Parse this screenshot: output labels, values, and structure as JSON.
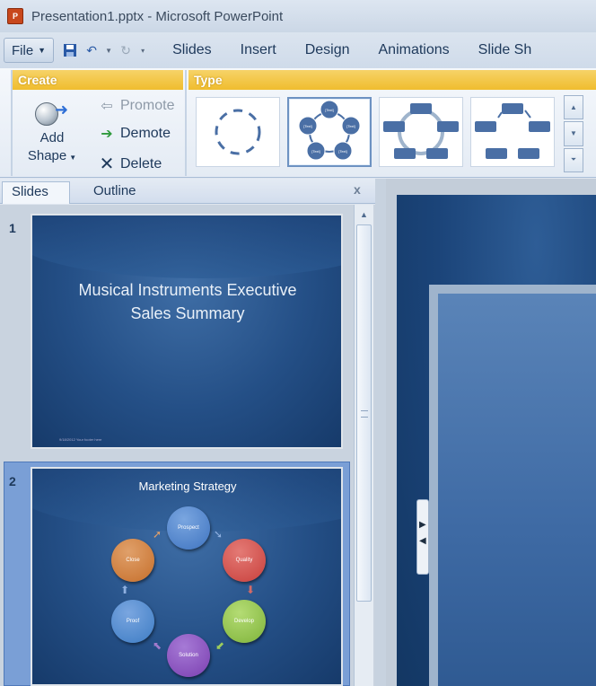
{
  "window": {
    "title": "Presentation1.pptx - Microsoft PowerPoint",
    "app_icon": "P"
  },
  "file_menu": {
    "label": "File"
  },
  "tabs": [
    "Slides",
    "Insert",
    "Design",
    "Animations",
    "Slide Sh"
  ],
  "ribbon": {
    "create_group": "Create",
    "type_group": "Type",
    "add_shape_line1": "Add",
    "add_shape_line2": "Shape",
    "promote": "Promote",
    "demote": "Demote",
    "delete": "Delete",
    "edge_labels": [
      "S",
      "T"
    ]
  },
  "smartart_thumb_text": "[Text]",
  "pane": {
    "tab_slides": "Slides",
    "tab_outline": "Outline",
    "close": "x"
  },
  "slides": [
    {
      "number": "1",
      "title_line1": "Musical Instruments Executive",
      "title_line2": "Sales Summary",
      "footer": "9/18/2012      Your footer here"
    },
    {
      "number": "2",
      "title": "Marketing Strategy",
      "nodes": [
        {
          "label": "Prospect",
          "color": "#3f74c0"
        },
        {
          "label": "Quality",
          "color": "#c8403c"
        },
        {
          "label": "Develop",
          "color": "#7fb33a"
        },
        {
          "label": "Solution",
          "color": "#7b3fb0"
        },
        {
          "label": "Proof",
          "color": "#3d7cc4"
        },
        {
          "label": "Close",
          "color": "#c66f2b"
        }
      ]
    }
  ],
  "colors": {
    "accent_gold": "#f0bd2e",
    "slide_blue": "#244f86",
    "selection": "#7a9fd6"
  }
}
